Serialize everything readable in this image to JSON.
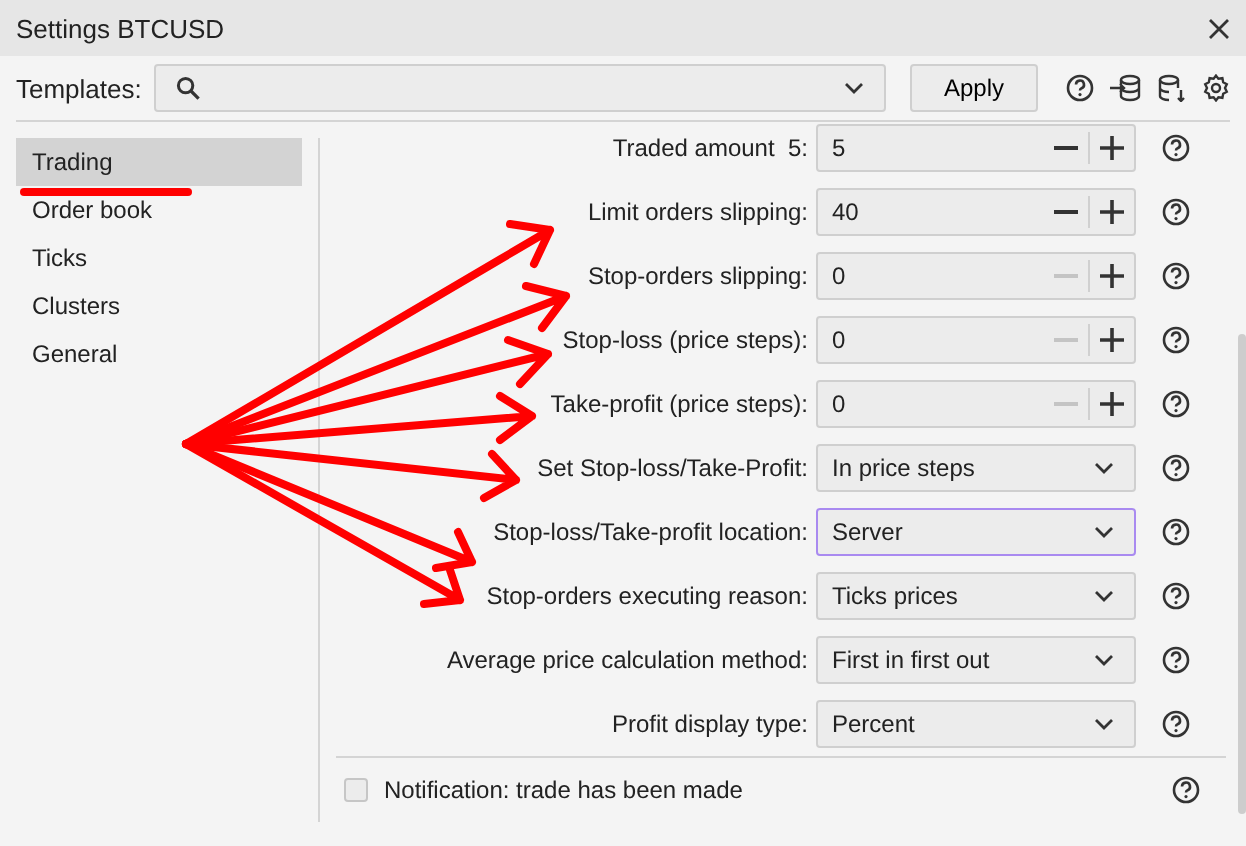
{
  "window": {
    "title": "Settings BTCUSD"
  },
  "templates": {
    "label": "Templates:",
    "button": "Apply"
  },
  "sidebar": {
    "items": [
      {
        "label": "Trading",
        "selected": true
      },
      {
        "label": "Order book",
        "selected": false
      },
      {
        "label": "Ticks",
        "selected": false
      },
      {
        "label": "Clusters",
        "selected": false
      },
      {
        "label": "General",
        "selected": false
      }
    ]
  },
  "settings": [
    {
      "kind": "number",
      "label": "Traded amount  5:",
      "value": "5",
      "minus_disabled": false
    },
    {
      "kind": "number",
      "label": "Limit orders slipping:",
      "value": "40",
      "minus_disabled": false
    },
    {
      "kind": "number",
      "label": "Stop-orders slipping:",
      "value": "0",
      "minus_disabled": true
    },
    {
      "kind": "number",
      "label": "Stop-loss (price steps):",
      "value": "0",
      "minus_disabled": true
    },
    {
      "kind": "number",
      "label": "Take-profit (price steps):",
      "value": "0",
      "minus_disabled": true
    },
    {
      "kind": "select",
      "label": "Set Stop-loss/Take-Profit:",
      "value": "In price steps",
      "focused": false
    },
    {
      "kind": "select",
      "label": "Stop-loss/Take-profit location:",
      "value": "Server",
      "focused": true
    },
    {
      "kind": "select",
      "label": "Stop-orders executing reason:",
      "value": "Ticks prices",
      "focused": false
    },
    {
      "kind": "select",
      "label": "Average price calculation method:",
      "value": "First in first out",
      "focused": false
    },
    {
      "kind": "select",
      "label": "Profit display type:",
      "value": "Percent",
      "focused": false
    }
  ],
  "notification": {
    "label": "Notification: trade has been made",
    "checked": false
  }
}
